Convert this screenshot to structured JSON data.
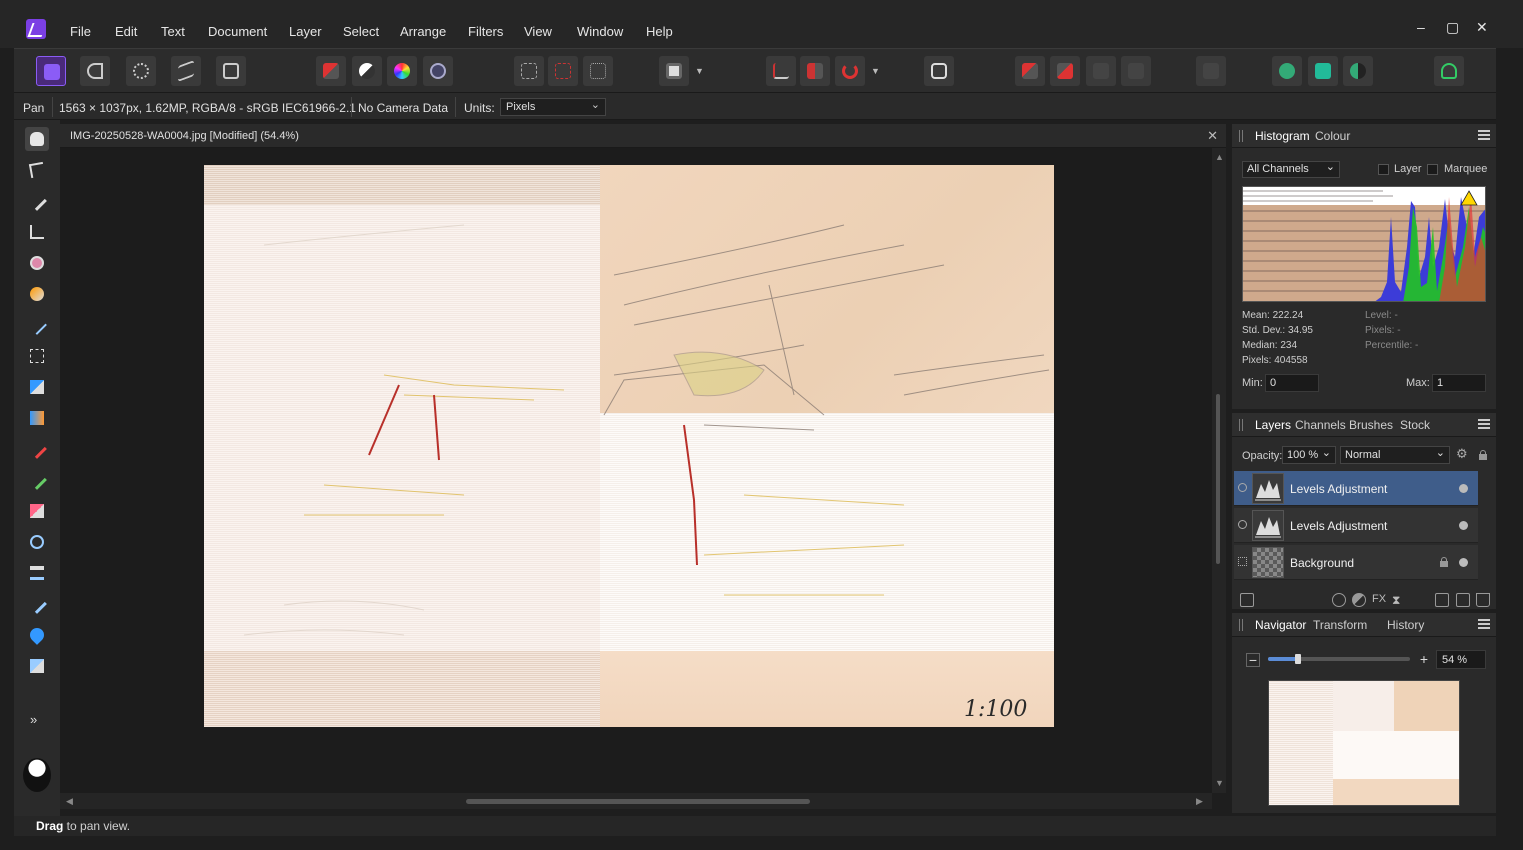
{
  "menu": {
    "items": [
      "File",
      "Edit",
      "Text",
      "Document",
      "Layer",
      "Select",
      "Arrange",
      "Filters",
      "View",
      "Window",
      "Help"
    ]
  },
  "window_controls": {
    "minimize": "–",
    "maximize": "▢",
    "close": "✕"
  },
  "context": {
    "tool": "Pan",
    "image_info": "1563 × 1037px, 1.62MP, RGBA/8 - sRGB IEC61966-2.1",
    "camera": "No Camera Data",
    "units_label": "Units:",
    "units_value": "Pixels"
  },
  "document": {
    "tab_title": "IMG-20250528-WA0004.jpg [Modified] (54.4%)",
    "close": "✕",
    "scale_text": "1:100"
  },
  "histogram_panel": {
    "tabs": [
      "Histogram",
      "Colour"
    ],
    "channel": "All Channels",
    "layer_label": "Layer",
    "marquee_label": "Marquee",
    "mean": "Mean: 222.24",
    "std_dev": "Std. Dev.: 34.95",
    "median": "Median: 234",
    "pixels": "Pixels: 404558",
    "level": "Level: -",
    "pixels_right": "Pixels: -",
    "percentile": "Percentile: -",
    "min_label": "Min:",
    "min_value": "0",
    "max_label": "Max:",
    "max_value": "1"
  },
  "layers_panel": {
    "tabs": [
      "Layers",
      "Channels",
      "Brushes",
      "Stock"
    ],
    "opacity_label": "Opacity:",
    "opacity_value": "100 %",
    "blend_mode": "Normal",
    "layers": [
      {
        "name": "Levels Adjustment",
        "selected": true
      },
      {
        "name": "Levels Adjustment",
        "selected": false
      },
      {
        "name": "Background",
        "selected": false,
        "locked": true
      }
    ]
  },
  "navigator_panel": {
    "tabs": [
      "Navigator",
      "Transform",
      "History"
    ],
    "zoom_value": "54 %",
    "zoom_fraction": 0.21
  },
  "status": {
    "bold": "Drag",
    "rest": " to pan view."
  },
  "colors": {
    "accent": "#8b5cf6",
    "selection": "#3f5d8a",
    "panel_bg": "#2a2a2a"
  }
}
